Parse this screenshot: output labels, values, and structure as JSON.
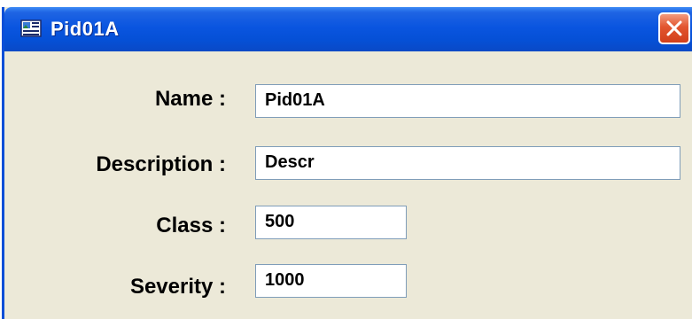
{
  "window": {
    "title": "Pid01A",
    "title_icon": "application-window-icon",
    "close_icon": "close-icon"
  },
  "form": {
    "name": {
      "label": "Name :",
      "value": "Pid01A"
    },
    "description": {
      "label": "Description :",
      "value": "Descr"
    },
    "class": {
      "label": "Class :",
      "value": "500"
    },
    "severity": {
      "label": "Severity :",
      "value": "1000"
    }
  },
  "colors": {
    "titlebar": "#0a55e0",
    "window_background": "#ece9d8",
    "close_button": "#e2552f",
    "field_border": "#7f9db9"
  }
}
